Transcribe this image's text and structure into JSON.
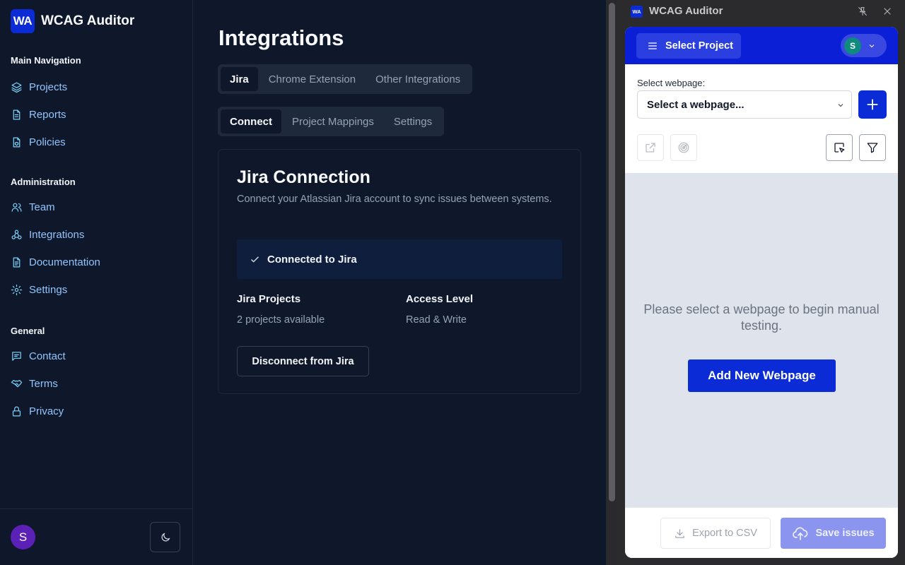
{
  "sidebar": {
    "brand_logo": "WA",
    "brand_name": "WCAG Auditor",
    "sections": {
      "main": {
        "heading": "Main Navigation",
        "items": [
          {
            "label": "Projects",
            "icon": "layers-icon"
          },
          {
            "label": "Reports",
            "icon": "file-text-icon"
          },
          {
            "label": "Policies",
            "icon": "file-shield-icon"
          }
        ]
      },
      "admin": {
        "heading": "Administration",
        "items": [
          {
            "label": "Team",
            "icon": "users-icon"
          },
          {
            "label": "Integrations",
            "icon": "webhook-icon"
          },
          {
            "label": "Documentation",
            "icon": "file-doc-icon"
          },
          {
            "label": "Settings",
            "icon": "gear-icon"
          }
        ]
      },
      "general": {
        "heading": "General",
        "items": [
          {
            "label": "Contact",
            "icon": "message-icon"
          },
          {
            "label": "Terms",
            "icon": "handshake-icon"
          },
          {
            "label": "Privacy",
            "icon": "lock-icon"
          }
        ]
      }
    },
    "user_initial": "S",
    "theme_toggle_icon": "moon-icon"
  },
  "main": {
    "title": "Integrations",
    "tabs": [
      "Jira",
      "Chrome Extension",
      "Other Integrations"
    ],
    "active_tab": "Jira",
    "subtabs": [
      "Connect",
      "Project Mappings",
      "Settings"
    ],
    "active_subtab": "Connect",
    "card": {
      "title": "Jira Connection",
      "description": "Connect your Atlassian Jira account to sync issues between systems.",
      "status": "Connected to Jira",
      "projects_label": "Jira Projects",
      "projects_value": "2 projects available",
      "access_label": "Access Level",
      "access_value": "Read & Write",
      "disconnect_label": "Disconnect from Jira"
    }
  },
  "extension": {
    "logo": "WA",
    "title": "WCAG Auditor",
    "select_project_label": "Select Project",
    "user_initial": "S",
    "webpage_label": "Select webpage:",
    "webpage_placeholder": "Select a webpage...",
    "empty_message": "Please select a webpage to begin manual testing.",
    "add_webpage_label": "Add New Webpage",
    "export_label": "Export to CSV",
    "save_label": "Save issues"
  },
  "colors": {
    "background": "#0f172a",
    "accent": "#0a2bd6",
    "nav_link": "#93c5fd"
  }
}
